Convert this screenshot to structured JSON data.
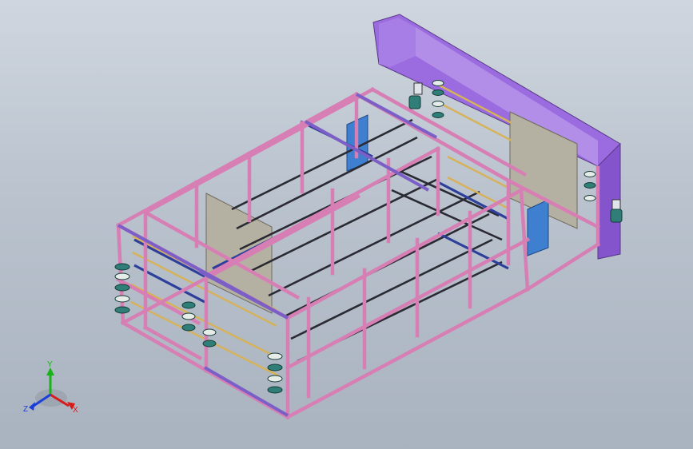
{
  "viewport": {
    "name": "3d-model-viewport",
    "background_top": "#cfd6df",
    "background_bottom": "#a9b3bf"
  },
  "model": {
    "frame_color": "#d77fb4",
    "frame_edge": "#7a3a66",
    "beam_color": "#7b5fc7",
    "panel_purple": "#9b6be0",
    "panel_blue": "#3f7fd0",
    "rail_yellow": "#d6b25a",
    "rail_dark": "#2a2a33",
    "plate_gray": "#b5b1a2",
    "motor_teal": "#2f7f78"
  },
  "triad": {
    "y_label": "Y",
    "x_label": "X",
    "z_label": "Z",
    "y_color": "#19b219",
    "x_color": "#d81b1b",
    "z_color": "#1b3fd8"
  }
}
